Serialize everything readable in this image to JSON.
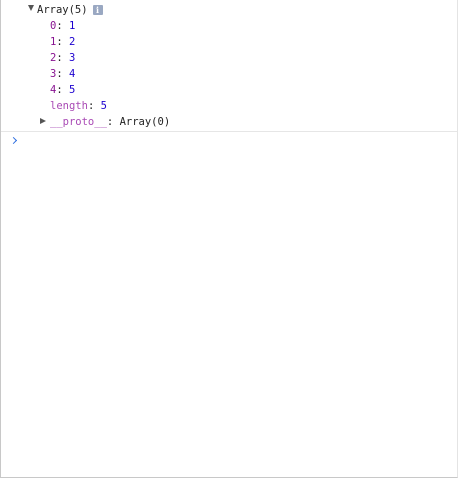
{
  "console": {
    "entry": {
      "summary": "Array(5)",
      "info_icon": "i",
      "items": [
        {
          "key": "0",
          "value": "1"
        },
        {
          "key": "1",
          "value": "2"
        },
        {
          "key": "2",
          "value": "3"
        },
        {
          "key": "3",
          "value": "4"
        },
        {
          "key": "4",
          "value": "5"
        }
      ],
      "length_key": "length",
      "length_value": "5",
      "proto_key": "__proto__",
      "proto_value": "Array(0)"
    },
    "colors": {
      "key": "#881391",
      "number": "#1c00cf",
      "prompt": "#2f6fe0"
    }
  }
}
